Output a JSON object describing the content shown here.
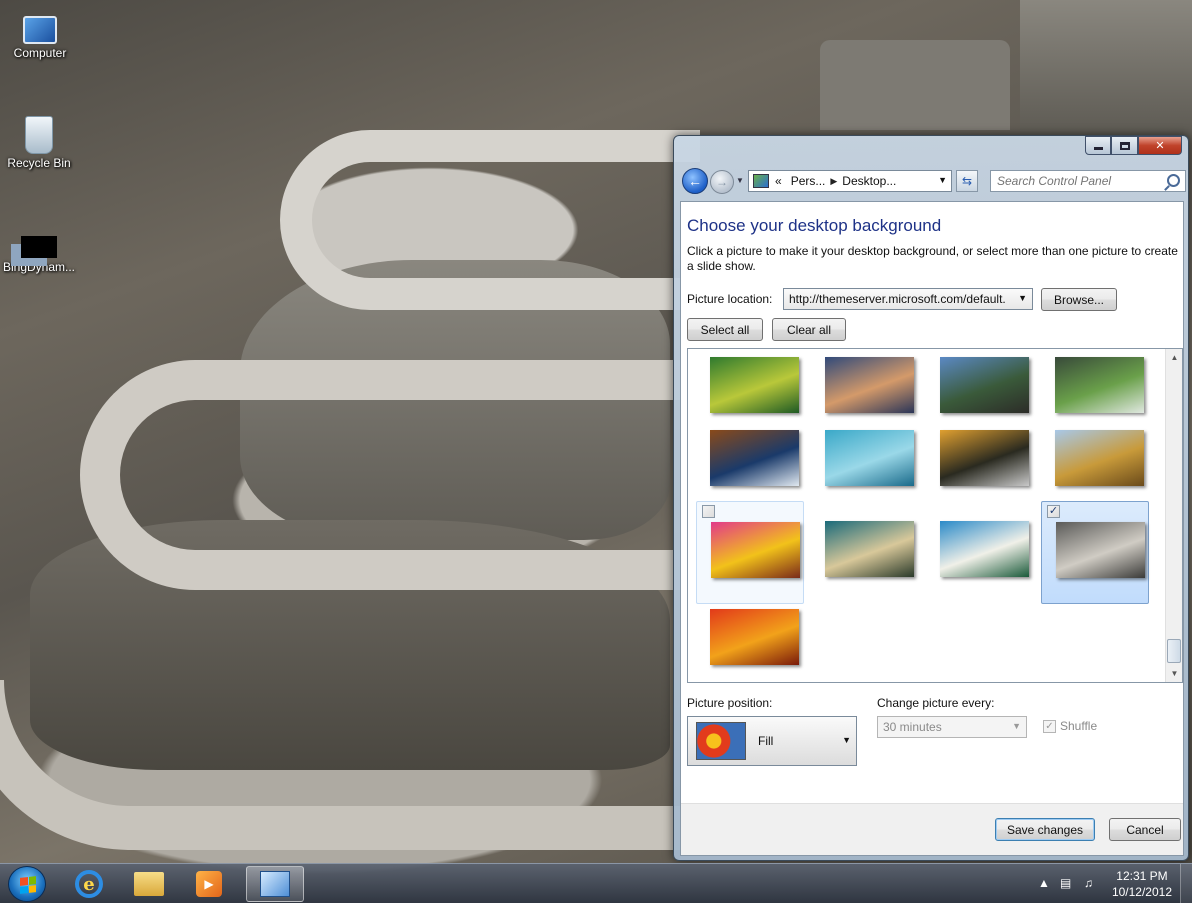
{
  "desktop": {
    "icons": [
      {
        "label": "Computer",
        "icon": "computer-icon"
      },
      {
        "label": "Recycle Bin",
        "icon": "recycle-bin-icon"
      },
      {
        "label": "BingDynam...",
        "icon": "bing-dynamic-icon"
      }
    ]
  },
  "window": {
    "caption_buttons": {
      "minimize": "minimize",
      "maximize": "maximize",
      "close": "✕"
    },
    "nav": {
      "back_icon": "back-arrow-icon",
      "forward_icon": "forward-arrow-icon",
      "breadcrumb_prefix": "«",
      "breadcrumb": [
        "Pers...",
        "Desktop..."
      ],
      "search_placeholder": "Search Control Panel"
    },
    "title": "Choose your desktop background",
    "description": "Click a picture to make it your desktop background, or select more than one picture to create a slide show.",
    "picture_location": {
      "label": "Picture location:",
      "value": "http://themeserver.microsoft.com/default.",
      "browse_label": "Browse..."
    },
    "select_all_label": "Select all",
    "clear_all_label": "Clear all",
    "gallery": {
      "thumbnails": [
        {
          "name": "green-coastline",
          "colors": [
            "#2f7a2e",
            "#b9c83a",
            "#1e5a24"
          ],
          "selected": false
        },
        {
          "name": "desert-plateau",
          "colors": [
            "#314a7a",
            "#d49a6a",
            "#2a3558"
          ],
          "selected": false
        },
        {
          "name": "goats-on-rocks",
          "colors": [
            "#5b89c4",
            "#3a5a3a",
            "#2c2c28"
          ],
          "selected": false
        },
        {
          "name": "waterfall-cliffs",
          "colors": [
            "#384a3a",
            "#6aa04a",
            "#e0e8e0"
          ],
          "selected": false
        },
        {
          "name": "coastal-waves",
          "colors": [
            "#8a4a1a",
            "#1a3a6a",
            "#e0e8f0"
          ],
          "selected": false
        },
        {
          "name": "turquoise-pools",
          "colors": [
            "#3aa8c8",
            "#9ad8e8",
            "#1a6a8a"
          ],
          "selected": false
        },
        {
          "name": "autumn-lake-house",
          "colors": [
            "#e0a030",
            "#2a2a20",
            "#c8c8c8"
          ],
          "selected": false
        },
        {
          "name": "caracal-savanna",
          "colors": [
            "#a8c8e8",
            "#c89a3a",
            "#6a4a1a"
          ],
          "selected": false
        },
        {
          "name": "coral-pink-yellow",
          "colors": [
            "#e23a8a",
            "#f2c21a",
            "#7a2a1a"
          ],
          "selected": false
        },
        {
          "name": "striped-fish",
          "colors": [
            "#1a6a7a",
            "#d8c89a",
            "#2a3a2a"
          ],
          "selected": false
        },
        {
          "name": "white-beach-aerial",
          "colors": [
            "#2a8ac8",
            "#f0f0e8",
            "#1a5a3a"
          ],
          "selected": false
        },
        {
          "name": "winding-mountain-road",
          "colors": [
            "#5a5a58",
            "#d0ccc4",
            "#3a3a38"
          ],
          "selected": true
        },
        {
          "name": "rambutan-fruit",
          "colors": [
            "#e23a1a",
            "#f2a21a",
            "#7a1a0a"
          ],
          "selected": false
        }
      ],
      "scroll_up": "▲",
      "scroll_down": "▼"
    },
    "picture_position": {
      "label": "Picture position:",
      "value": "Fill"
    },
    "change_picture": {
      "label": "Change picture every:",
      "value": "30 minutes"
    },
    "shuffle": {
      "label": "Shuffle",
      "checked": true
    },
    "save_label": "Save changes",
    "cancel_label": "Cancel"
  },
  "taskbar": {
    "pinned": [
      "internet-explorer-icon",
      "windows-explorer-icon",
      "media-player-icon",
      "control-panel-icon"
    ],
    "tray_icons": [
      "show-hidden-icons-icon",
      "network-icon",
      "volume-icon"
    ],
    "time": "12:31 PM",
    "date": "10/12/2012"
  }
}
